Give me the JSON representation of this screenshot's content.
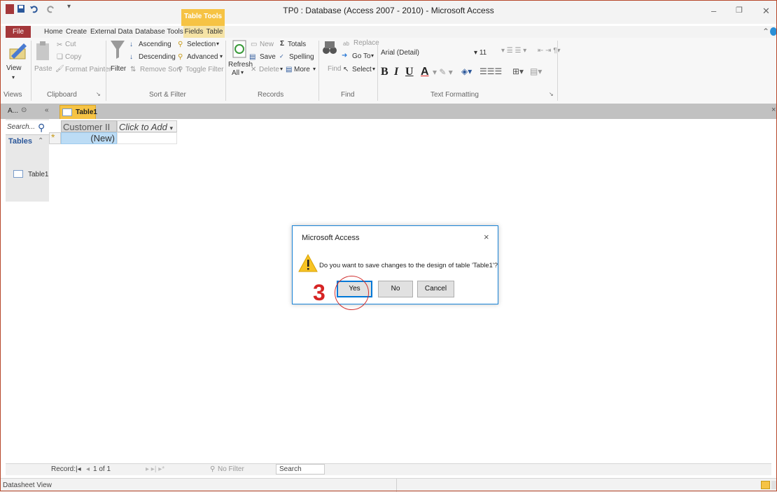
{
  "window": {
    "title": "TP0 : Database (Access 2007 - 2010) - Microsoft Access",
    "context_tab_group": "Table Tools"
  },
  "tabs": [
    "File",
    "Home",
    "Create",
    "External Data",
    "Database Tools",
    "Fields",
    "Table"
  ],
  "ribbon": {
    "views": {
      "view": "View",
      "group": "Views"
    },
    "clipboard": {
      "paste": "Paste",
      "cut": "Cut",
      "copy": "Copy",
      "format_painter": "Format Painter",
      "group": "Clipboard"
    },
    "sort_filter": {
      "filter": "Filter",
      "ascending": "Ascending",
      "descending": "Descending",
      "remove_sort": "Remove Sort",
      "selection": "Selection",
      "advanced": "Advanced",
      "toggle_filter": "Toggle Filter",
      "group": "Sort & Filter"
    },
    "records": {
      "refresh": "Refresh",
      "all": "All",
      "new": "New",
      "save": "Save",
      "delete": "Delete",
      "totals": "Totals",
      "spelling": "Spelling",
      "more": "More",
      "group": "Records"
    },
    "find": {
      "find": "Find",
      "replace": "Replace",
      "goto": "Go To",
      "select": "Select",
      "group": "Find"
    },
    "text_formatting": {
      "font": "Arial (Detail)",
      "size": "11",
      "group": "Text Formatting",
      "bold": "B",
      "italic": "I",
      "underline": "U",
      "font_color_glyph": "A"
    }
  },
  "nav_pane": {
    "title": "A...",
    "search_placeholder": "Search...",
    "section": "Tables",
    "items": [
      "Table1"
    ]
  },
  "document_tab": "Table1",
  "datasheet": {
    "columns": [
      "Customer II",
      "Click to Add"
    ],
    "new_row_label": "(New)",
    "new_row_marker": "*"
  },
  "record_nav": {
    "label": "Record:",
    "position": "1 of 1",
    "filter": "No Filter",
    "search": "Search"
  },
  "status": {
    "view": "Datasheet View"
  },
  "dialog": {
    "title": "Microsoft Access",
    "message": "Do you want to save changes to the design of table 'Table1'?",
    "buttons": {
      "yes": "Yes",
      "no": "No",
      "cancel": "Cancel"
    },
    "close_glyph": "×"
  },
  "annotation": {
    "step": "3",
    "color": "#d62424"
  },
  "colors": {
    "file_tab": "#a4373a",
    "table_tools": "#f6c344",
    "dialog_border": "#1883d7"
  }
}
